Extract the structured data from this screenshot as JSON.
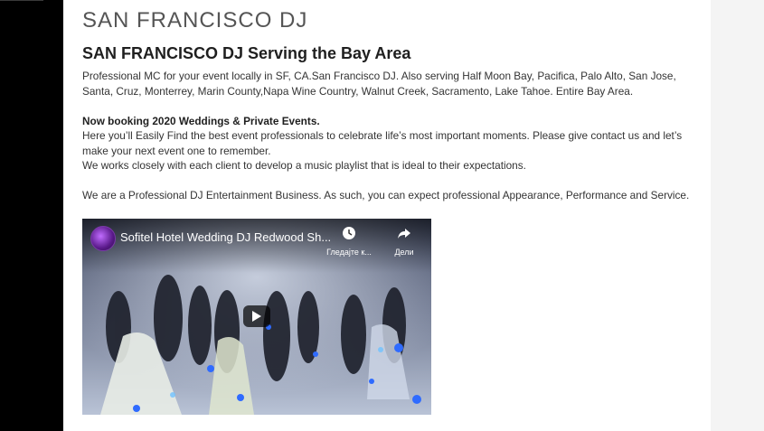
{
  "site": {
    "title": "SAN FRANCISCO DJ"
  },
  "post": {
    "heading": "SAN FRANCISCO DJ Serving the Bay Area",
    "paragraphs": {
      "intro": "Professional MC for your event locally in SF, CA.San Francisco DJ. Also serving Half Moon Bay, Pacifica, Palo Alto, San Jose, Santa, Cruz, Monterrey,  Marin County,Napa Wine Country, Walnut Creek, Sacramento, Lake Tahoe. Entire Bay Area.",
      "booking_bold": "Now booking 2020 Weddings & Private Events.",
      "booking_line1": "Here you’ll Easily Find the best event professionals to celebrate life’s most important moments. Please give contact us and let’s make your next event one to remember.",
      "booking_line2": "We works closely with each client to develop a music playlist that is ideal to their expectations.",
      "professional": "We are a Professional DJ Entertainment Business. As such, you can expect professional Appearance, Performance and Service."
    }
  },
  "video": {
    "title": "Sofitel Hotel Wedding DJ Redwood Sh...",
    "watch_later_label": "Гледајте к...",
    "share_label": "Дели",
    "icons": {
      "watch_later": "clock-icon",
      "share": "share-arrow-icon",
      "play": "play-icon",
      "avatar": "channel-avatar"
    }
  },
  "colors": {
    "left_sidebar": "#000000",
    "right_sidebar": "#f4f4f4",
    "text": "#333333",
    "heading": "#1f1f1f",
    "site_title": "#555555"
  }
}
